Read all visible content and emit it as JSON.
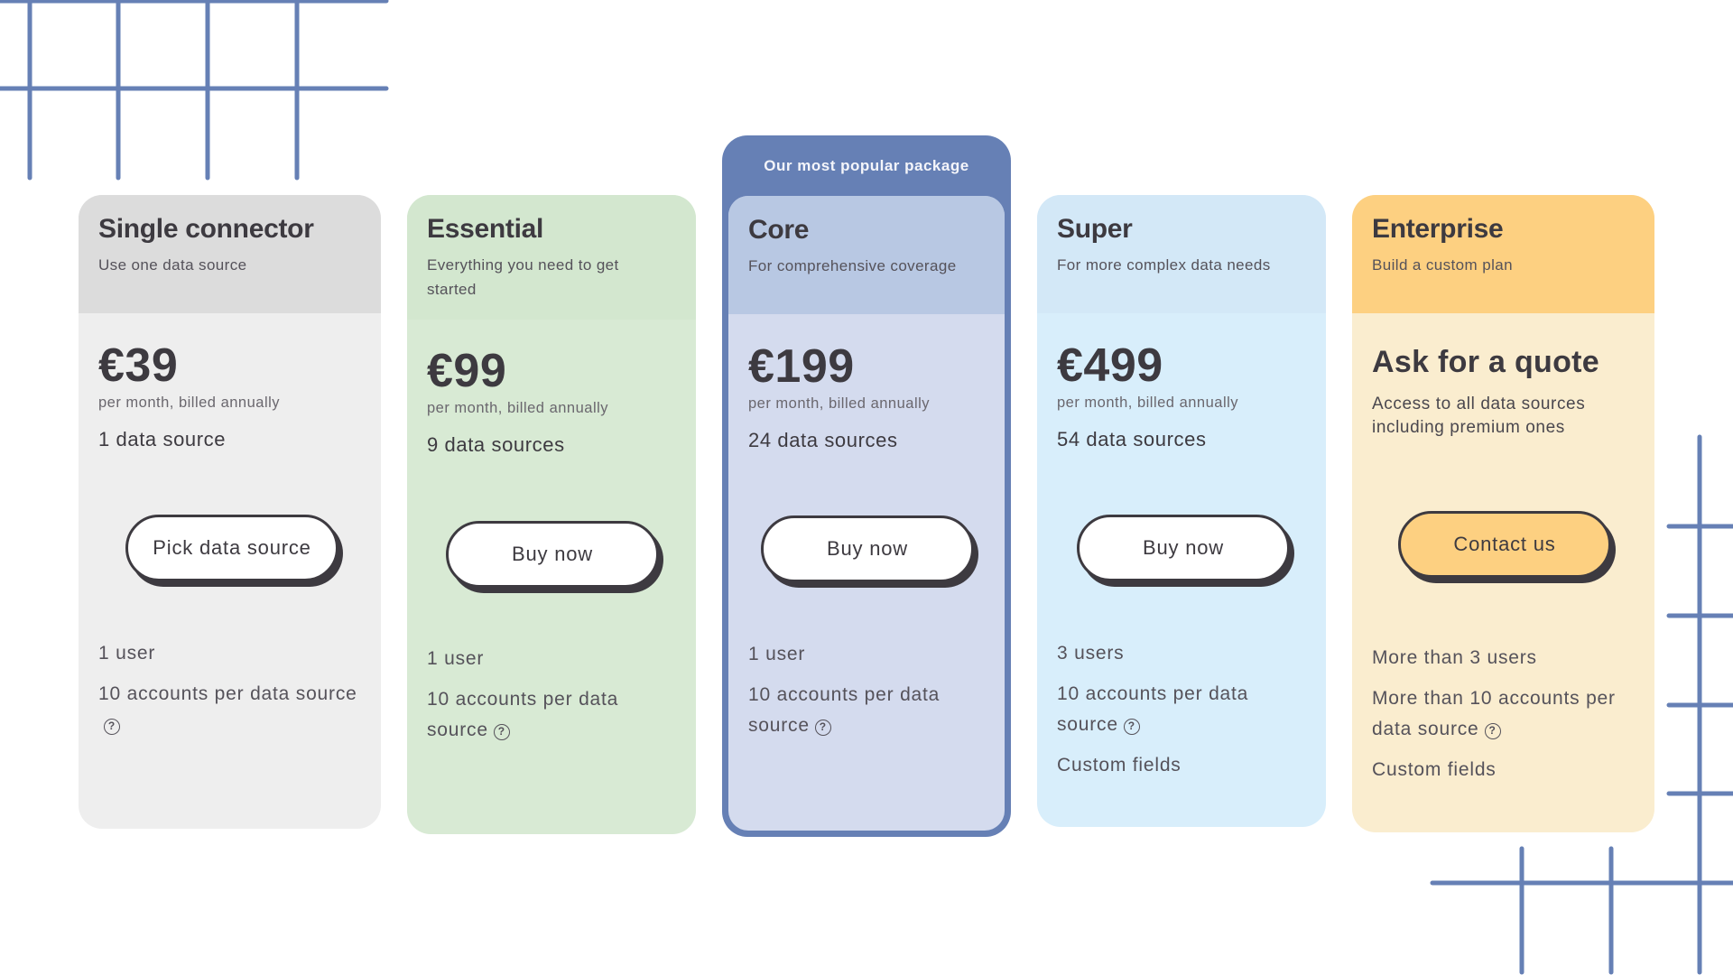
{
  "accent_color": "#6680b5",
  "popular_badge": "Our most popular package",
  "plans": [
    {
      "name": "Single connector",
      "tagline": "Use one data source",
      "price": "€39",
      "billing": "per month, billed annually",
      "sources": "1 data source",
      "button": "Pick data source",
      "features": [
        "1 user",
        "10 accounts per data source"
      ],
      "header_color": "#dcdcdc",
      "body_color": "#eeeeee"
    },
    {
      "name": "Essential",
      "tagline": "Everything you need to get started",
      "price": "€99",
      "billing": "per month, billed annually",
      "sources": "9 data sources",
      "button": "Buy now",
      "features": [
        "1 user",
        "10 accounts per data source"
      ],
      "header_color": "#d3e7cf",
      "body_color": "#d8ead4"
    },
    {
      "name": "Core",
      "tagline": "For comprehensive coverage",
      "price": "€199",
      "billing": "per month, billed annually",
      "sources": "24 data sources",
      "button": "Buy now",
      "features": [
        "1 user",
        "10 accounts per data source"
      ],
      "header_color": "#b8c8e3",
      "body_color": "#d4dbee",
      "popular": true
    },
    {
      "name": "Super",
      "tagline": "For more complex data needs",
      "price": "€499",
      "billing": "per month, billed annually",
      "sources": "54 data sources",
      "button": "Buy now",
      "features": [
        "3 users",
        "10 accounts per data source",
        "Custom fields"
      ],
      "header_color": "#d3e8f7",
      "body_color": "#d8eefb"
    },
    {
      "name": "Enterprise",
      "tagline": "Build a custom plan",
      "quote_title": "Ask for a quote",
      "quote_desc": "Access to all data sources including premium ones",
      "button": "Contact us",
      "features": [
        "More than 3 users",
        "More than 10 accounts per data source",
        "Custom fields"
      ],
      "header_color": "#fdd081",
      "body_color": "#faedcf"
    }
  ],
  "help_icon": "question-circle-icon"
}
